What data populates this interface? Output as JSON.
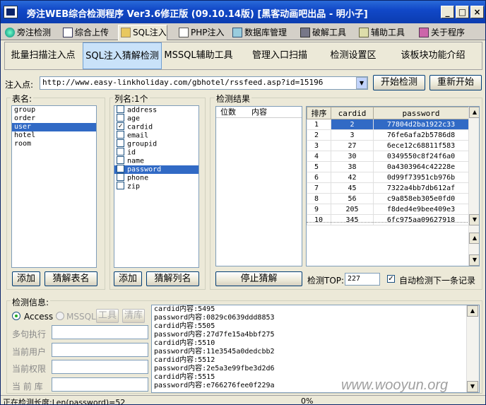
{
  "window": {
    "title": "旁注WEB综合检测程序 Ver3.6修正版 (09.10.14版) [黑客动画吧出品 - 明小子]"
  },
  "main_tabs": [
    "旁注检测",
    "综合上传",
    "SQL注入",
    "PHP注入",
    "数据库管理",
    "破解工具",
    "辅助工具",
    "关于程序"
  ],
  "sub_tabs": [
    "批量扫描注入点",
    "SQL注入猜解检测",
    "MSSQL辅助工具",
    "管理入口扫描",
    "检测设置区",
    "该板块功能介绍"
  ],
  "inject": {
    "label": "注入点:",
    "url": "http://www.easy-linkholiday.com/gbhotel/rssfeed.asp?id=15196",
    "start_btn": "开始检测",
    "restart_btn": "重新开始"
  },
  "tables": {
    "label": "表名:",
    "items": [
      "group",
      "order",
      "user",
      "hotel",
      "room"
    ],
    "selected": "user",
    "add_btn": "添加",
    "guess_btn": "猜解表名"
  },
  "columns": {
    "label": "列名:1个",
    "items": [
      {
        "name": "address",
        "checked": false
      },
      {
        "name": "age",
        "checked": false
      },
      {
        "name": "cardid",
        "checked": true
      },
      {
        "name": "email",
        "checked": false
      },
      {
        "name": "groupid",
        "checked": false
      },
      {
        "name": "id",
        "checked": false
      },
      {
        "name": "name",
        "checked": false
      },
      {
        "name": "password",
        "checked": true
      },
      {
        "name": "phone",
        "checked": false
      },
      {
        "name": "zip",
        "checked": false
      }
    ],
    "selected": "password",
    "add_btn": "添加",
    "guess_btn": "猜解列名"
  },
  "results": {
    "label": "检测结果",
    "col_pos": "位数",
    "col_content": "内容",
    "stop_btn": "停止猜解"
  },
  "grid": {
    "headers": [
      "排序",
      "cardid",
      "password"
    ],
    "rows": [
      [
        "1",
        "2",
        "77804d2ba1922c33"
      ],
      [
        "2",
        "3",
        "76fe6afa2b5786d8"
      ],
      [
        "3",
        "27",
        "6ece12c68811f583"
      ],
      [
        "4",
        "30",
        "0349550c8f24f6a0"
      ],
      [
        "5",
        "38",
        "0a4303964c42228e"
      ],
      [
        "6",
        "42",
        "0d99f73951cb976b"
      ],
      [
        "7",
        "45",
        "7322a4bb7db612af"
      ],
      [
        "8",
        "56",
        "c9a858eb305e0fd0"
      ],
      [
        "9",
        "205",
        "f8ded4e9bee409e3"
      ],
      [
        "10",
        "345",
        "6fc975aa09627918"
      ]
    ]
  },
  "top": {
    "label": "检测TOP:",
    "value": "227",
    "auto_label": "自动检测下一条记录"
  },
  "detect_info": {
    "label": "检测信息:",
    "access": "Access",
    "mssql": "MSSQL",
    "tool_btn": "工具",
    "clear_btn": "清库",
    "fields": [
      "多句执行",
      "当前用户",
      "当前权限",
      "当 前 库"
    ]
  },
  "log": [
    "cardid内容:5495",
    "password内容:0829c0639ddd8853",
    "cardid内容:5505",
    "password内容:27d7fe15a4bbf275",
    "cardid内容:5510",
    "password内容:11e3545a0dedcbb2",
    "cardid内容:5512",
    "password内容:2e5a3e99fbe3d2d6",
    "cardid内容:5515",
    "password内容:e766276fee0f229a"
  ],
  "watermark": "www.wooyun.org",
  "status": {
    "text": "正在检测长度:Len(password)=52",
    "progress": "0%"
  }
}
